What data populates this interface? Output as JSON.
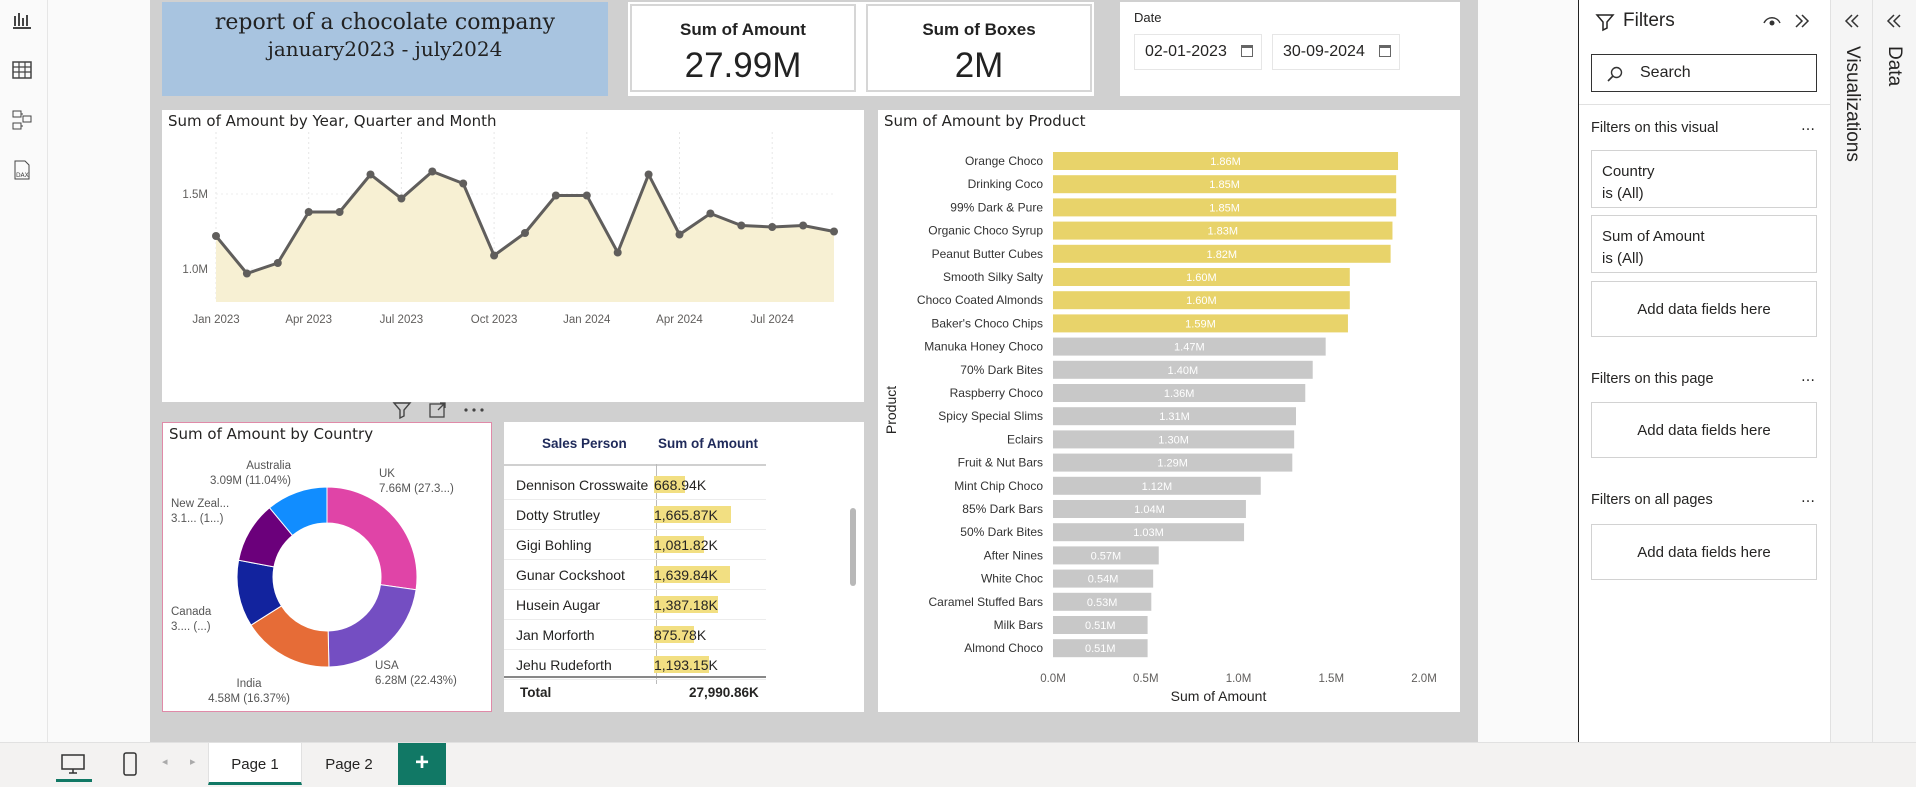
{
  "title": {
    "line1": "report of a chocolate company",
    "line2": "january2023 - july2024"
  },
  "kpis": [
    {
      "label": "Sum of Amount",
      "value": "27.99M"
    },
    {
      "label": "Sum of Boxes",
      "value": "2M"
    }
  ],
  "date_filter": {
    "label": "Date",
    "start": "02-01-2023",
    "end": "30-09-2024"
  },
  "line_chart_title": "Sum of Amount by Year, Quarter and Month",
  "product_chart_title": "Sum of Amount by Product",
  "country_chart_title": "Sum of Amount by Country",
  "table": {
    "headers": [
      "Sales Person",
      "Sum of Amount"
    ],
    "rows": [
      {
        "name": "Dennison Crosswaite",
        "value": "668.94K",
        "fraction": 0.36
      },
      {
        "name": "Dotty Strutley",
        "value": "1,665.87K",
        "fraction": 0.89
      },
      {
        "name": "Gigi Bohling",
        "value": "1,081.82K",
        "fraction": 0.58
      },
      {
        "name": "Gunar Cockshoot",
        "value": "1,639.84K",
        "fraction": 0.88
      },
      {
        "name": "Husein Augar",
        "value": "1,387.18K",
        "fraction": 0.74
      },
      {
        "name": "Jan Morforth",
        "value": "875.78K",
        "fraction": 0.47
      },
      {
        "name": "Jehu Rudeforth",
        "value": "1,193.15K",
        "fraction": 0.64
      }
    ],
    "total_label": "Total",
    "total_value": "27,990.86K"
  },
  "chart_data": [
    {
      "type": "area",
      "title": "Sum of Amount by Year, Quarter and Month",
      "x": [
        "Jan 2023",
        "Feb 2023",
        "Mar 2023",
        "Apr 2023",
        "May 2023",
        "Jun 2023",
        "Jul 2023",
        "Aug 2023",
        "Sep 2023",
        "Oct 2023",
        "Nov 2023",
        "Dec 2023",
        "Jan 2024",
        "Feb 2024",
        "Mar 2024",
        "Apr 2024",
        "May 2024",
        "Jun 2024",
        "Jul 2024",
        "Aug 2024",
        "Sep 2024"
      ],
      "x_tick_labels": [
        "Jan 2023",
        "Apr 2023",
        "Jul 2023",
        "Oct 2023",
        "Jan 2024",
        "Apr 2024",
        "Jul 2024"
      ],
      "y_tick_labels": [
        "1.0M",
        "1.5M"
      ],
      "values": [
        1.22,
        0.97,
        1.04,
        1.38,
        1.38,
        1.63,
        1.47,
        1.65,
        1.57,
        1.09,
        1.24,
        1.49,
        1.49,
        1.11,
        1.63,
        1.23,
        1.37,
        1.29,
        1.28,
        1.29,
        1.25
      ],
      "ylim": [
        0.78,
        1.98
      ],
      "color": "#605e5c",
      "fill": "#f7f0d3"
    },
    {
      "type": "bar",
      "title": "Sum of Amount by Product",
      "xlabel": "Sum of Amount",
      "ylabel": "Product",
      "x_tick_labels": [
        "0.0M",
        "0.5M",
        "1.0M",
        "1.5M",
        "2.0M"
      ],
      "xlim": [
        0,
        2.0
      ],
      "categories": [
        "Orange Choco",
        "Drinking Coco",
        "99% Dark & Pure",
        "Organic Choco Syrup",
        "Peanut Butter Cubes",
        "Smooth Silky Salty",
        "Choco Coated Almonds",
        "Baker's Choco Chips",
        "Manuka Honey Choco",
        "70% Dark Bites",
        "Raspberry Choco",
        "Spicy Special Slims",
        "Eclairs",
        "Fruit & Nut Bars",
        "Mint Chip Choco",
        "85% Dark Bars",
        "50% Dark Bites",
        "After Nines",
        "White Choc",
        "Caramel Stuffed Bars",
        "Milk Bars",
        "Almond Choco"
      ],
      "values": [
        1.86,
        1.85,
        1.85,
        1.83,
        1.82,
        1.6,
        1.6,
        1.59,
        1.47,
        1.4,
        1.36,
        1.31,
        1.3,
        1.29,
        1.12,
        1.04,
        1.03,
        0.57,
        0.54,
        0.53,
        0.51,
        0.51
      ],
      "labels": [
        "1.86M",
        "1.85M",
        "1.85M",
        "1.83M",
        "1.82M",
        "1.60M",
        "1.60M",
        "1.59M",
        "1.47M",
        "1.40M",
        "1.36M",
        "1.31M",
        "1.30M",
        "1.29M",
        "1.12M",
        "1.04M",
        "1.03M",
        "0.57M",
        "0.54M",
        "0.53M",
        "0.51M",
        "0.51M"
      ],
      "highlight_count": 8,
      "highlight_color": "#e8d36a",
      "other_color": "#c8c8c8"
    },
    {
      "type": "pie",
      "title": "Sum of Amount by Country",
      "slices": [
        {
          "name": "UK",
          "value": 27.3,
          "label": "7.66M (27.3...)",
          "color": "#e044a7"
        },
        {
          "name": "USA",
          "value": 22.43,
          "label": "6.28M (22.43%)",
          "color": "#744ec2"
        },
        {
          "name": "India",
          "value": 16.37,
          "label": "4.58M (16.37%)",
          "color": "#e66c37"
        },
        {
          "name": "Canada",
          "value": 12.0,
          "label": "3.... (...)",
          "color": "#12239e"
        },
        {
          "name": "New Zeal...",
          "value": 11.0,
          "label": "3.1... (1...)",
          "color": "#6b007b"
        },
        {
          "name": "Australia",
          "value": 11.04,
          "label": "3.09M (11.04%)",
          "color": "#118dff"
        }
      ]
    }
  ],
  "filters_pane": {
    "title": "Filters",
    "search_placeholder": "Search",
    "on_visual": "Filters on this visual",
    "on_page": "Filters on this page",
    "on_all": "Filters on all pages",
    "cards": [
      {
        "field": "Country",
        "state": "is (All)"
      },
      {
        "field": "Sum of Amount",
        "state": "is (All)"
      }
    ],
    "add_fields": "Add data fields here"
  },
  "side_tabs": {
    "visualizations": "Visualizations",
    "data": "Data"
  },
  "pages": [
    "Page 1",
    "Page 2"
  ],
  "add_page": "+"
}
